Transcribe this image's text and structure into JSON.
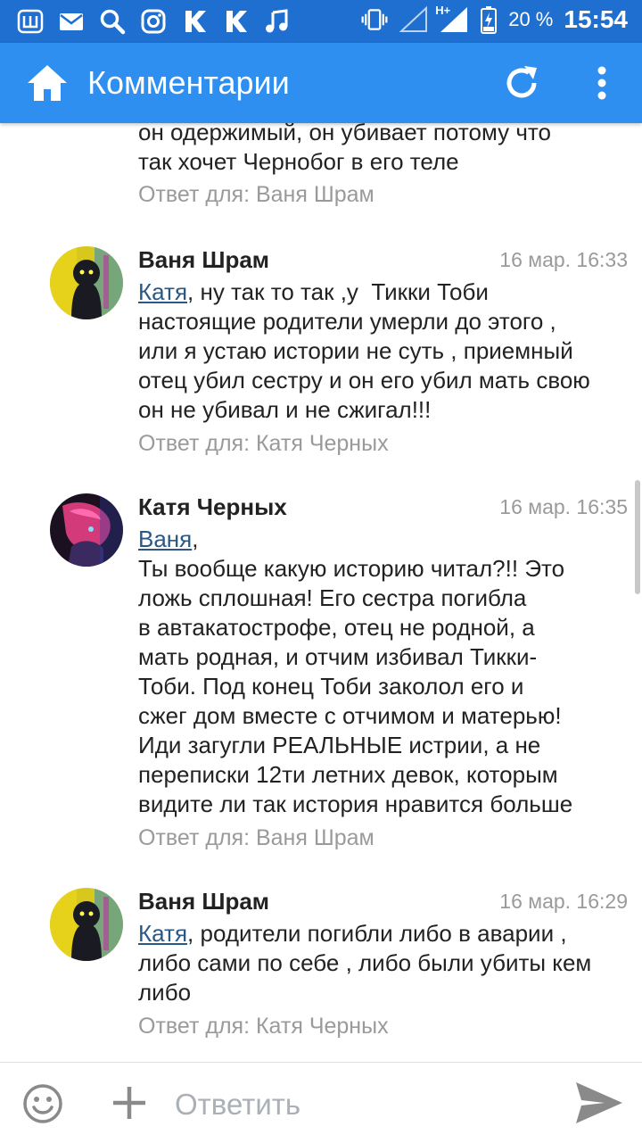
{
  "status_bar": {
    "left_icons": [
      "w-app-icon",
      "mail-icon",
      "search-icon",
      "instagram-icon",
      "k-app-icon",
      "k-app-icon",
      "music-icon"
    ],
    "right_icons": [
      "vibrate-icon",
      "signal-icon",
      "signal-hplus-icon",
      "battery-charging-icon"
    ],
    "battery": "20 %",
    "time": "15:54",
    "hplus": "H+"
  },
  "toolbar": {
    "title": "Комментарии",
    "home_icon": "home-icon",
    "refresh_icon": "refresh-icon",
    "menu_icon": "more-vert-icon"
  },
  "comments": [
    {
      "partial": true,
      "lines": [
        "он одержимый, он убивает потому что",
        "так хочет Чернобог в его теле"
      ],
      "reply_to": "Ответ для: Ваня Шрам"
    },
    {
      "author": "Ваня Шрам",
      "date": "16 мар. 16:33",
      "mention": "Катя",
      "first_line_rest": ", ну так то так ,у  Тикки Тоби",
      "lines": [
        "настоящие родители умерли до этого ,",
        "или я устаю истории не суть , приемный",
        "отец убил сестру и он его убил мать свою",
        "он не убивал и не сжигал!!!"
      ],
      "reply_to": "Ответ для: Катя Черных"
    },
    {
      "author": "Катя Черных",
      "date": "16 мар. 16:35",
      "mention": "Ваня",
      "first_line_rest": ",",
      "lines": [
        "Ты вообще какую историю читал?!! Это",
        "ложь сплошная! Его сестра погибла",
        "в автакатострофе, отец не родной, а",
        "мать родная, и отчим избивал Тикки-",
        "Тоби. Под конец Тоби заколол его и",
        "сжег дом вместе с отчимом и матерью!",
        "Иди загугли РЕАЛЬНЫЕ истрии, а не",
        "переписки 12ти летних девок, которым",
        "видите ли так история нравится больше"
      ],
      "reply_to": "Ответ для: Ваня Шрам"
    },
    {
      "author": "Ваня Шрам",
      "date": "16 мар. 16:29",
      "mention": "Катя",
      "first_line_rest": ", родители погибли либо в аварии ,",
      "lines": [
        "либо сами по себе , либо были убиты кем",
        "либо"
      ],
      "reply_to": "Ответ для: Катя Черных"
    }
  ],
  "composer": {
    "placeholder": "Ответить",
    "emoji_icon": "emoji-icon",
    "attach_icon": "plus-icon",
    "send_icon": "send-icon"
  },
  "colors": {
    "status_bar": "#1e6fd0",
    "toolbar": "#2f8ff0",
    "link": "#2a5885",
    "meta_text": "#9a9a9a"
  }
}
